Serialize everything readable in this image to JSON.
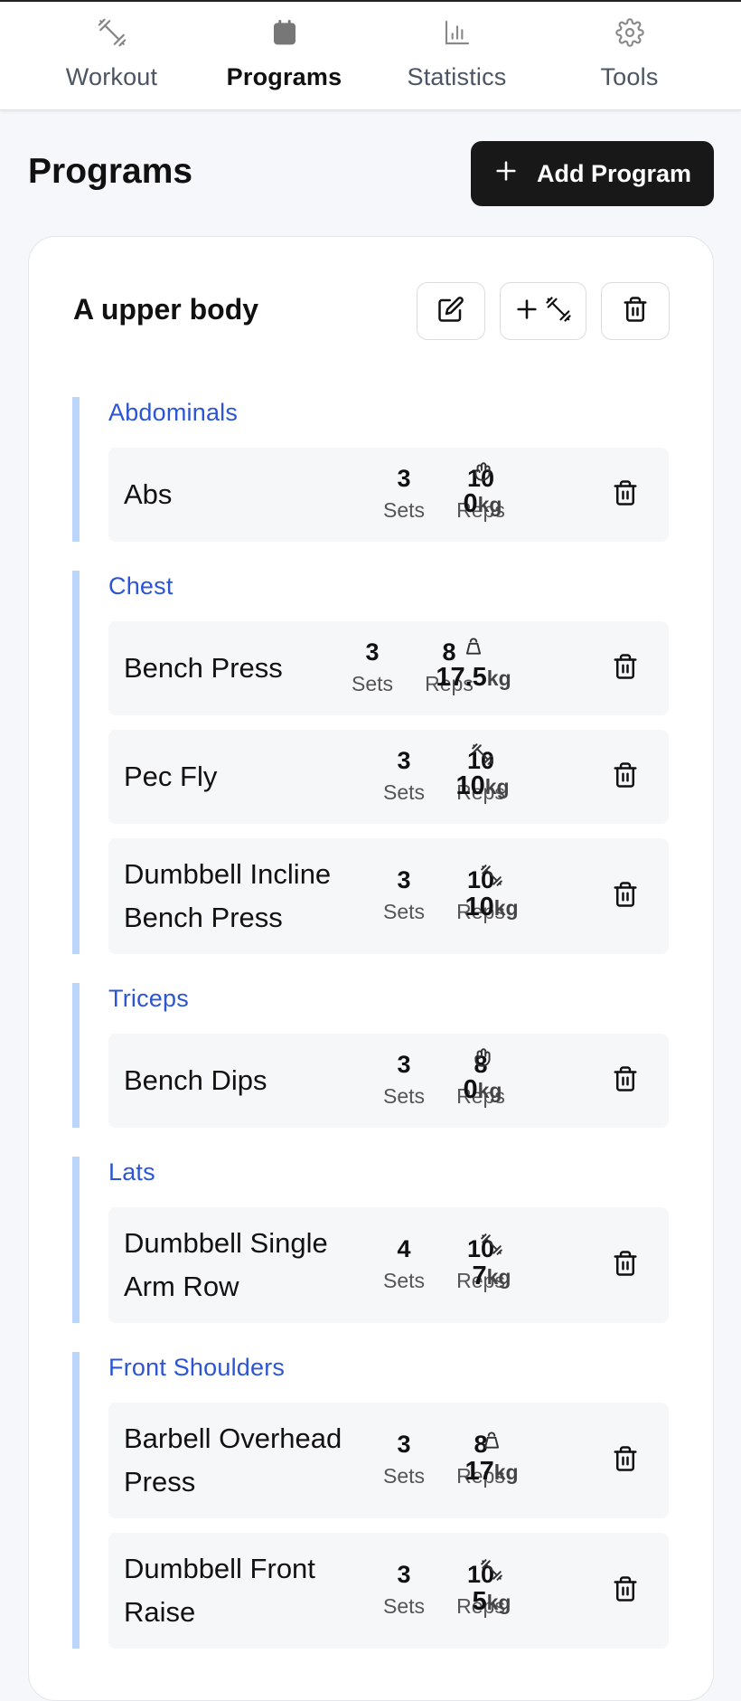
{
  "nav": {
    "tabs": [
      {
        "label": "Workout",
        "icon": "dumbbell-icon",
        "active": false
      },
      {
        "label": "Programs",
        "icon": "calendar-icon",
        "active": true
      },
      {
        "label": "Statistics",
        "icon": "bar-chart-icon",
        "active": false
      },
      {
        "label": "Tools",
        "icon": "gear-icon",
        "active": false
      }
    ]
  },
  "header": {
    "title": "Programs",
    "add_label": "Add Program",
    "add_icon": "plus-icon"
  },
  "program": {
    "name": "A upper body",
    "actions": [
      "edit-icon",
      "add-exercise-icon",
      "trash-icon"
    ],
    "groups": [
      {
        "name": "Abdominals",
        "exercises": [
          {
            "name": "Abs",
            "name_lines": [
              "Abs"
            ],
            "sets": "3",
            "reps": "10",
            "weight": "0",
            "unit": "kg",
            "equipment": "bodyweight-icon"
          }
        ]
      },
      {
        "name": "Chest",
        "exercises": [
          {
            "name": "Bench Press",
            "name_lines": [
              "Bench Press"
            ],
            "sets": "3",
            "reps": "8",
            "weight": "17.5",
            "unit": "kg",
            "equipment": "kettlebell-icon"
          },
          {
            "name": "Pec Fly",
            "name_lines": [
              "Pec Fly"
            ],
            "sets": "3",
            "reps": "10",
            "weight": "10",
            "unit": "kg",
            "equipment": "dumbbell-icon"
          },
          {
            "name": "Dumbbell Incline Bench Press",
            "name_lines": [
              "Dumbbell Incline",
              "Bench Press"
            ],
            "sets": "3",
            "reps": "10",
            "weight": "10",
            "unit": "kg",
            "equipment": "dumbbell-icon"
          }
        ]
      },
      {
        "name": "Triceps",
        "exercises": [
          {
            "name": "Bench Dips",
            "name_lines": [
              "Bench Dips"
            ],
            "sets": "3",
            "reps": "8",
            "weight": "0",
            "unit": "kg",
            "equipment": "bodyweight-icon"
          }
        ]
      },
      {
        "name": "Lats",
        "exercises": [
          {
            "name": "Dumbbell Single Arm Row",
            "name_lines": [
              "Dumbbell Single",
              "Arm Row"
            ],
            "sets": "4",
            "reps": "10",
            "weight": "7",
            "unit": "kg",
            "equipment": "dumbbell-icon"
          }
        ]
      },
      {
        "name": "Front Shoulders",
        "exercises": [
          {
            "name": "Barbell Overhead Press",
            "name_lines": [
              "Barbell Overhead",
              "Press"
            ],
            "sets": "3",
            "reps": "8",
            "weight": "17",
            "unit": "kg",
            "equipment": "kettlebell-icon"
          },
          {
            "name": "Dumbbell Front Raise",
            "name_lines": [
              "Dumbbell Front",
              "Raise"
            ],
            "sets": "3",
            "reps": "10",
            "weight": "5",
            "unit": "kg",
            "equipment": "dumbbell-icon"
          }
        ]
      }
    ]
  },
  "labels": {
    "sets": "Sets",
    "reps": "Reps"
  }
}
